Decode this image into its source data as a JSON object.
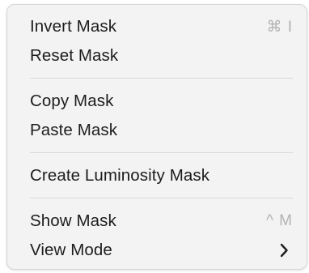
{
  "menu": {
    "items": {
      "invert_mask": {
        "label": "Invert Mask",
        "shortcut": "⌘ I"
      },
      "reset_mask": {
        "label": "Reset Mask"
      },
      "copy_mask": {
        "label": "Copy Mask"
      },
      "paste_mask": {
        "label": "Paste Mask"
      },
      "create_luminosity_mask": {
        "label": "Create Luminosity Mask"
      },
      "show_mask": {
        "label": "Show Mask",
        "shortcut": "^ M"
      },
      "view_mode": {
        "label": "View Mode",
        "submenu_icon": "chevron-right-icon"
      }
    }
  },
  "colors": {
    "menu_background": "#f3f3f3",
    "text": "#1d1d1f",
    "shortcut_text": "#b3b3b3",
    "separator": "#d9d9d9"
  }
}
